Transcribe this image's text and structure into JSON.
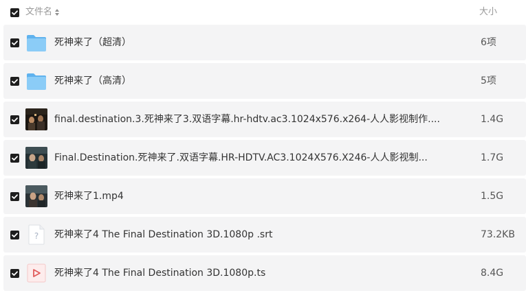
{
  "header": {
    "name_label": "文件名",
    "size_label": "大小"
  },
  "files": [
    {
      "name": "死神来了（超清）",
      "size": "6项",
      "icon": "folder-icon"
    },
    {
      "name": "死神来了（高清）",
      "size": "5项",
      "icon": "folder-icon"
    },
    {
      "name": "final.destination.3.死神来了3.双语字幕.hr-hdtv.ac3.1024x576.x264-人人影视制作....",
      "size": "1.4G",
      "icon": "video-thumbnail"
    },
    {
      "name": "Final.Destination.死神来了.双语字幕.HR-HDTV.AC3.1024X576.X246-人人影视制...",
      "size": "1.7G",
      "icon": "video-thumbnail"
    },
    {
      "name": "死神来了1.mp4",
      "size": "1.5G",
      "icon": "video-thumbnail"
    },
    {
      "name": "死神来了4 The Final Destination 3D.1080p .srt",
      "size": "73.2KB",
      "icon": "unknown-file-icon"
    },
    {
      "name": "死神来了4 The Final Destination 3D.1080p.ts",
      "size": "8.4G",
      "icon": "video-file-icon"
    }
  ],
  "colors": {
    "row_background": "#f4f4f5",
    "checkbox": "#1e1e1e",
    "folder": "#7cc3f5",
    "play_red": "#e05a5a"
  }
}
